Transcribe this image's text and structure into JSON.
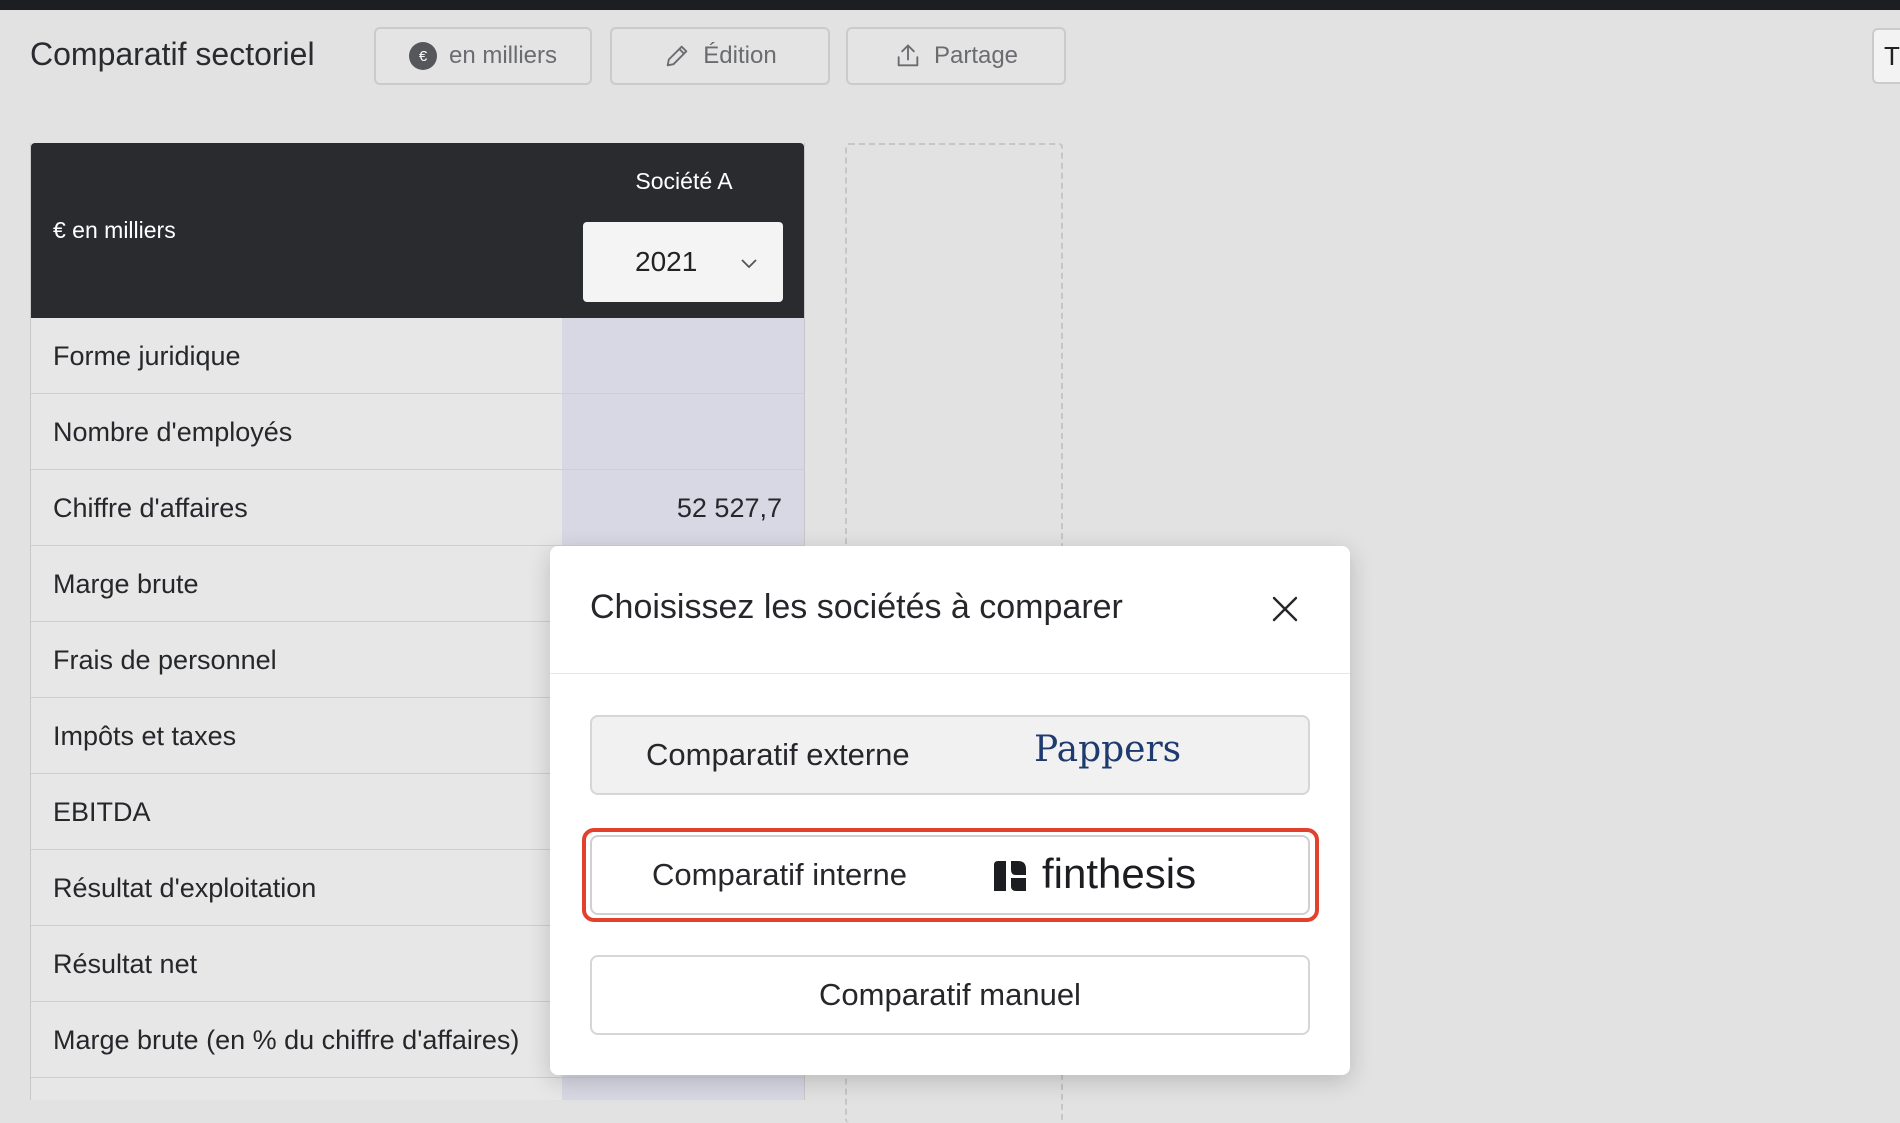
{
  "header": {
    "title": "Comparatif sectoriel",
    "unit_button": {
      "icon": "euro-icon",
      "icon_glyph": "€",
      "label": "en milliers"
    },
    "edit_button": {
      "icon": "pencil-icon",
      "label": "Édition"
    },
    "share_button": {
      "icon": "share-icon",
      "label": "Partage"
    },
    "edge_button_label": "T"
  },
  "table": {
    "unit_label": "€ en milliers",
    "company": "Société A",
    "year": "2021",
    "rows": [
      {
        "label": "Forme juridique",
        "value": ""
      },
      {
        "label": "Nombre d'employés",
        "value": ""
      },
      {
        "label": "Chiffre d'affaires",
        "value": "52 527,7"
      },
      {
        "label": "Marge brute",
        "value": ""
      },
      {
        "label": "Frais de personnel",
        "value": ""
      },
      {
        "label": "Impôts et taxes",
        "value": ""
      },
      {
        "label": "EBITDA",
        "value": ""
      },
      {
        "label": "Résultat d'exploitation",
        "value": ""
      },
      {
        "label": "Résultat net",
        "value": ""
      },
      {
        "label": "Marge brute (en % du chiffre d'affaires)",
        "value": ""
      }
    ]
  },
  "modal": {
    "title": "Choisissez les sociétés à comparer",
    "options": [
      {
        "label": "Comparatif externe",
        "brand": "Pappers"
      },
      {
        "label": "Comparatif interne",
        "brand": "finthesis"
      },
      {
        "label": "Comparatif manuel",
        "brand": ""
      }
    ]
  },
  "colors": {
    "accent_highlight": "#e2412e",
    "table_header_bg": "#2a2b2f",
    "value_column_bg": "#d8d8e4",
    "pappers_brand": "#1e3a6e"
  }
}
